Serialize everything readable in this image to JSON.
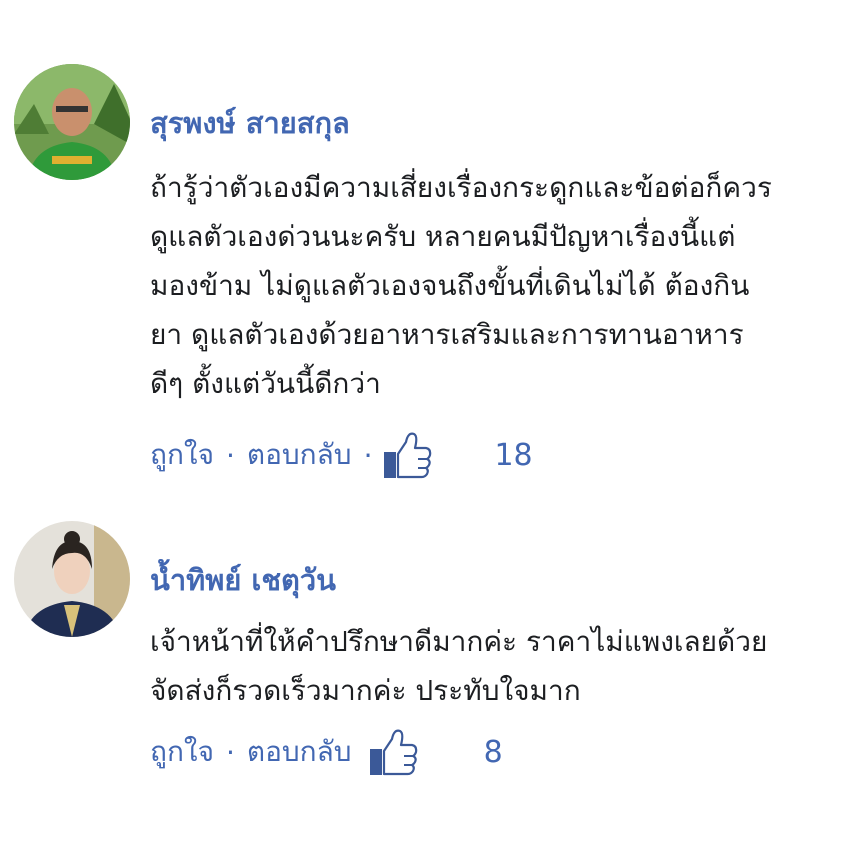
{
  "comments": [
    {
      "author": "สุรพงษ์ สายสกุล",
      "text": "ถ้ารู้ว่าตัวเองมีความเสี่ยงเรื่องกระดูกและข้อต่อก็ควร\nดูแลตัวเองด่วนนะครับ หลายคนมีปัญหาเรื่องนี้แต่\nมองข้าม ไม่ดูแลตัวเองจนถึงขั้นที่เดินไม่ได้ ต้องกิน\nยา ดูแลตัวเองด้วยอาหารเสริมและการทานอาหาร\nดีๆ ตั้งแต่วันนี้ดีกว่า",
      "like_label": "ถูกใจ",
      "separator": "·",
      "reply_label": "ตอบกลับ",
      "like_count": "18",
      "like_icon": "thumbs-up-icon"
    },
    {
      "author": "น้ำทิพย์ เชตุวัน",
      "text": "เจ้าหน้าที่ให้คำปรึกษาดีมากค่ะ ราคาไม่แพงเลยด้วย\nจัดส่งก็รวดเร็วมากค่ะ ประทับใจมาก",
      "like_label": "ถูกใจ",
      "separator": "·",
      "reply_label": "ตอบกลับ",
      "like_count": "8",
      "like_icon": "thumbs-up-icon"
    }
  ],
  "colors": {
    "link": "#4267b2",
    "text": "#1c1e21",
    "like_icon_fill": "#3b5998"
  }
}
